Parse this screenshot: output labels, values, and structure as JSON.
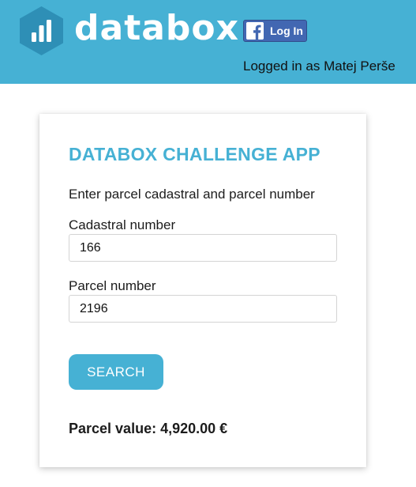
{
  "header": {
    "logo_text": "databox",
    "facebook_button_label": "Log In",
    "logged_in_text": "Logged in as Matej Perše",
    "colors": {
      "header_bg": "#46b1d4",
      "facebook_blue": "#4267b2"
    }
  },
  "form": {
    "title": "DATABOX CHALLENGE APP",
    "intro": "Enter parcel cadastral and parcel number",
    "cadastral_label": "Cadastral number",
    "cadastral_value": "166",
    "parcel_label": "Parcel number",
    "parcel_value": "2196",
    "search_button_label": "SEARCH",
    "result_text": "Parcel value: 4,920.00 €"
  },
  "icons": [
    "databox-logo-icon",
    "facebook-icon"
  ]
}
